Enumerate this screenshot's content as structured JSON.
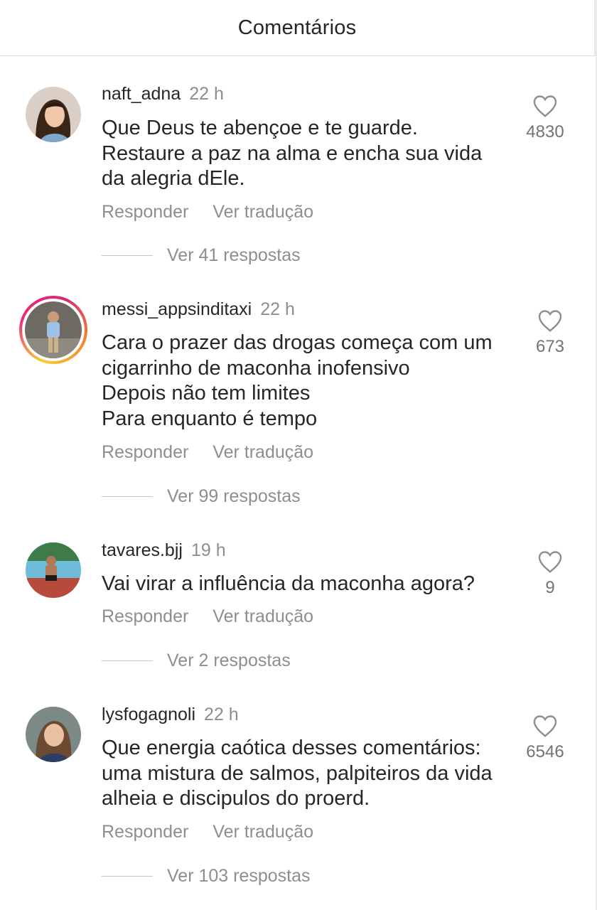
{
  "header": {
    "title": "Comentários"
  },
  "comments": [
    {
      "username": "naft_adna",
      "time": "22 h",
      "text": "Que Deus te abençoe e te guarde.\nRestaure a paz na alma e encha sua vida da alegria dEle.",
      "reply_label": "Responder",
      "translate_label": "Ver tradução",
      "likes": "4830",
      "view_replies": "Ver 41 respostas"
    },
    {
      "username": "messi_appsinditaxi",
      "time": "22 h",
      "text": "Cara o prazer das drogas começa com um cigarrinho de maconha inofensivo\nDepois não tem limites\nPara enquanto é tempo",
      "reply_label": "Responder",
      "translate_label": "Ver tradução",
      "likes": "673",
      "view_replies": "Ver 99 respostas"
    },
    {
      "username": "tavares.bjj",
      "time": "19 h",
      "text": "Vai virar a influência da maconha agora?",
      "reply_label": "Responder",
      "translate_label": "Ver tradução",
      "likes": "9",
      "view_replies": "Ver 2 respostas"
    },
    {
      "username": "lysfogagnoli",
      "time": "22 h",
      "text": "Que energia caótica desses comentários: uma mistura de salmos,  palpiteiros da vida alheia e discipulos do proerd.",
      "reply_label": "Responder",
      "translate_label": "Ver tradução",
      "likes": "6546",
      "view_replies": "Ver 103 respostas"
    }
  ],
  "icons": {
    "like": "heart-outline-icon"
  },
  "colors": {
    "primary_text": "#262626",
    "secondary_text": "#8e8e8e",
    "divider": "#dbdbdb"
  }
}
